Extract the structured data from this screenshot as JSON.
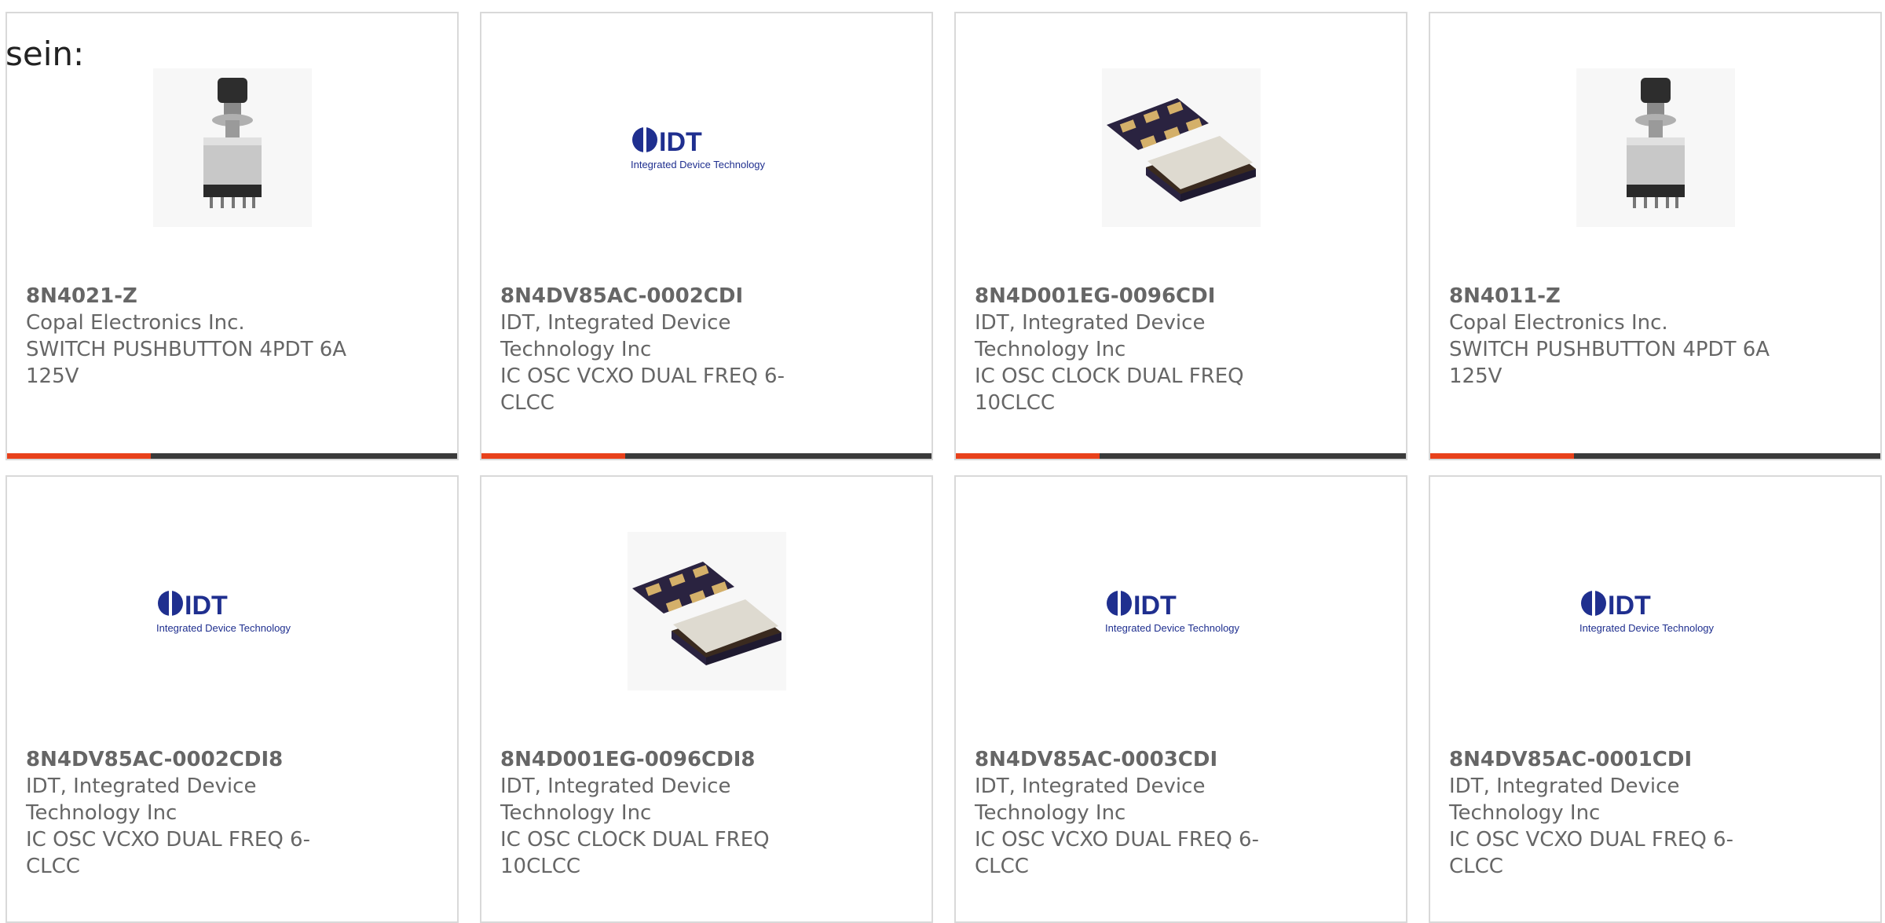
{
  "lead_text": "sein:",
  "colors": {
    "accent": "#e8411b",
    "track": "#3a3a3a",
    "idt_blue": "#1f2f8f"
  },
  "cards": [
    {
      "part": "8N4021-Z",
      "lines": [
        "Copal Electronics Inc.",
        "SWITCH PUSHBUTTON 4PDT 6A",
        "125V"
      ],
      "image": "pushbutton-switch-image"
    },
    {
      "part": "8N4DV85AC-0002CDI",
      "lines": [
        "IDT, Integrated Device",
        "Technology Inc",
        "IC OSC VCXO DUAL FREQ 6-CLCC"
      ],
      "image": "idt-logo-image",
      "logo_text": "IDT",
      "logo_sub": "Integrated Device Technology"
    },
    {
      "part": "8N4D001EG-0096CDI",
      "lines": [
        "IDT, Integrated Device",
        "Technology Inc",
        "IC OSC CLOCK DUAL FREQ",
        "10CLCC"
      ],
      "image": "oscillator-chip-image"
    },
    {
      "part": "8N4011-Z",
      "lines": [
        "Copal Electronics Inc.",
        "SWITCH PUSHBUTTON 4PDT 6A",
        "125V"
      ],
      "image": "pushbutton-switch-image"
    },
    {
      "part": "8N4DV85AC-0002CDI8",
      "lines": [
        "IDT, Integrated Device",
        "Technology Inc",
        "IC OSC VCXO DUAL FREQ 6-CLCC"
      ],
      "image": "idt-logo-image",
      "logo_text": "IDT",
      "logo_sub": "Integrated Device Technology"
    },
    {
      "part": "8N4D001EG-0096CDI8",
      "lines": [
        "IDT, Integrated Device",
        "Technology Inc",
        "IC OSC CLOCK DUAL FREQ",
        "10CLCC"
      ],
      "image": "oscillator-chip-image"
    },
    {
      "part": "8N4DV85AC-0003CDI",
      "lines": [
        "IDT, Integrated Device",
        "Technology Inc",
        "IC OSC VCXO DUAL FREQ 6-CLCC"
      ],
      "image": "idt-logo-image",
      "logo_text": "IDT",
      "logo_sub": "Integrated Device Technology"
    },
    {
      "part": "8N4DV85AC-0001CDI",
      "lines": [
        "IDT, Integrated Device",
        "Technology Inc",
        "IC OSC VCXO DUAL FREQ 6-CLCC"
      ],
      "image": "idt-logo-image",
      "logo_text": "IDT",
      "logo_sub": "Integrated Device Technology"
    }
  ]
}
